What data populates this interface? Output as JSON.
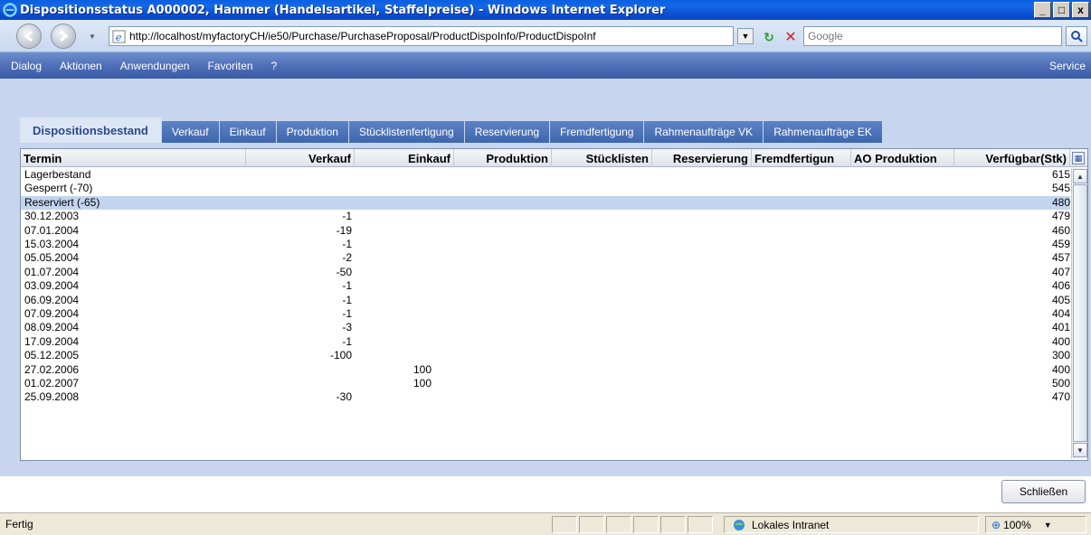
{
  "window": {
    "title": "Dispositionsstatus A000002, Hammer (Handelsartikel, Staffelpreise) - Windows Internet Explorer",
    "min": "_",
    "max": "□",
    "close": "x"
  },
  "address": {
    "url": "http://localhost/myfactoryCH/ie50/Purchase/PurchaseProposal/ProductDispoInfo/ProductDispoInf",
    "search_placeholder": "Google"
  },
  "menu": {
    "items": [
      "Dialog",
      "Aktionen",
      "Anwendungen",
      "Favoriten",
      "?"
    ],
    "service": "Service"
  },
  "tabs": [
    "Dispositionsbestand",
    "Verkauf",
    "Einkauf",
    "Produktion",
    "Stücklistenfertigung",
    "Reservierung",
    "Fremdfertigung",
    "Rahmenaufträge VK",
    "Rahmenaufträge EK"
  ],
  "table": {
    "headers": [
      "Termin",
      "Verkauf",
      "Einkauf",
      "Produktion",
      "Stücklisten",
      "Reservierung",
      "Fremdfertigun",
      "AO Produktion",
      "Verfügbar(Stk)"
    ],
    "rows": [
      {
        "termin": "Lagerbestand",
        "verkauf": "",
        "einkauf": "",
        "verf": "615"
      },
      {
        "termin": "Gesperrt (-70)",
        "verkauf": "",
        "einkauf": "",
        "verf": "545"
      },
      {
        "termin": "Reserviert (-65)",
        "verkauf": "",
        "einkauf": "",
        "verf": "480"
      },
      {
        "termin": "30.12.2003",
        "verkauf": "-1",
        "einkauf": "",
        "verf": "479"
      },
      {
        "termin": "07.01.2004",
        "verkauf": "-19",
        "einkauf": "",
        "verf": "460"
      },
      {
        "termin": "15.03.2004",
        "verkauf": "-1",
        "einkauf": "",
        "verf": "459"
      },
      {
        "termin": "05.05.2004",
        "verkauf": "-2",
        "einkauf": "",
        "verf": "457"
      },
      {
        "termin": "01.07.2004",
        "verkauf": "-50",
        "einkauf": "",
        "verf": "407"
      },
      {
        "termin": "03.09.2004",
        "verkauf": "-1",
        "einkauf": "",
        "verf": "406"
      },
      {
        "termin": "06.09.2004",
        "verkauf": "-1",
        "einkauf": "",
        "verf": "405"
      },
      {
        "termin": "07.09.2004",
        "verkauf": "-1",
        "einkauf": "",
        "verf": "404"
      },
      {
        "termin": "08.09.2004",
        "verkauf": "-3",
        "einkauf": "",
        "verf": "401"
      },
      {
        "termin": "17.09.2004",
        "verkauf": "-1",
        "einkauf": "",
        "verf": "400"
      },
      {
        "termin": "05.12.2005",
        "verkauf": "-100",
        "einkauf": "",
        "verf": "300"
      },
      {
        "termin": "27.02.2006",
        "verkauf": "",
        "einkauf": "100",
        "verf": "400"
      },
      {
        "termin": "01.02.2007",
        "verkauf": "",
        "einkauf": "100",
        "verf": "500"
      },
      {
        "termin": "25.09.2008",
        "verkauf": "-30",
        "einkauf": "",
        "verf": "470"
      }
    ]
  },
  "buttons": {
    "close": "Schließen"
  },
  "status": {
    "text": "Fertig",
    "zone": "Lokales Intranet",
    "zoom": "100%"
  }
}
